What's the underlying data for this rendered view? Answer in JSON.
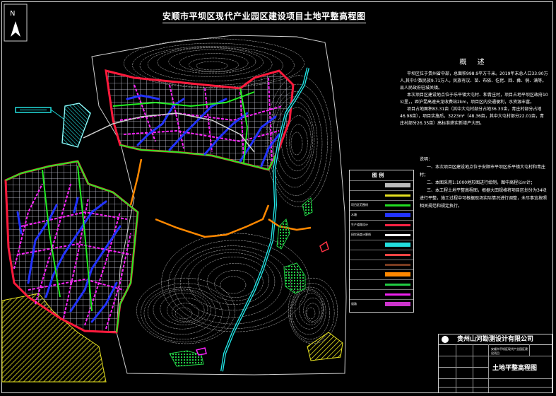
{
  "title": "安顺市平坝区现代产业园区建设项目土地平整高程图",
  "north_label": "N",
  "overview": {
    "heading": "概 述",
    "paragraphs": [
      "平坝区位于贵州省中部，总面积998.9平方千米。2019年末总人口33.90万人,其中少数民族9.71万人，民族有汉、苗、布依、仡佬、回、彝、侗、满等。县人民政府驻城关镇。",
      "本次项目区建设地点位于乐平镇大屯村、和青庄村，项目占地平坝区政府10公里，，距沪昆高速天龙收费站2km，项目区内交通便利，水资源丰富。",
      "项目占地面积83.31亩（其中大屯村部分占地36.33亩，青庄村部分占地46.98亩），项目实施后，3223m²（48.36亩，其中大屯村部分22.01亩，青庄村部分26.35亩）高标准耕实新增产大田。"
    ]
  },
  "notes": {
    "heading": "说明：",
    "items": [
      "一、本次项目区建设地点位于安顺市平坝区乐平镇大屯村和青庄村；",
      "二、本图采用1:1000地形图进行绘制，图中高程以m计；",
      "三、本工程土地平整高程图，根据大田规格将项目区划分为34块进行平整，施工过程中可根据现场实际情况进行调整，未尽事宜按照相关规范和规定执行。"
    ]
  },
  "legend": {
    "title": "图 例",
    "rows": [
      {
        "label": "",
        "color": "#bbbbbb"
      },
      {
        "label": "",
        "color": "#e5e020"
      },
      {
        "label": "项目区范围线",
        "color": "#22dd22"
      },
      {
        "label": "水塘",
        "color": "#2233ff"
      },
      {
        "label": "生产道路设计",
        "color": "#ff2244"
      },
      {
        "label": "田坎高度计算线",
        "color": "#ffffff"
      },
      {
        "label": "",
        "color": "#22dddd"
      },
      {
        "label": "",
        "color": "#ff4444"
      },
      {
        "label": "",
        "color": "#7a3c20"
      },
      {
        "label": "",
        "color": "#ff8800"
      },
      {
        "label": "",
        "color": "#22cc44"
      },
      {
        "label": "",
        "color": "#ee22ee"
      },
      {
        "label": "道路",
        "color": "#cc33cc"
      }
    ]
  },
  "title_block": {
    "company": "贵州山河勘测设计有限公司",
    "project": "安顺市平坝区现代产业园区建设项目",
    "drawing_name": "土地平整高程图"
  },
  "colors": {
    "boundary": "#22ee22",
    "grid": "#d0d0e0",
    "field_red": "#ff1a3c",
    "magenta": "#ff22ff",
    "blue_channel": "#2233ff",
    "cyan_river": "#22e5e5",
    "orange_road": "#ff8800",
    "contour": "#cfcfcf",
    "yellow_hatch": "#e5e020"
  }
}
